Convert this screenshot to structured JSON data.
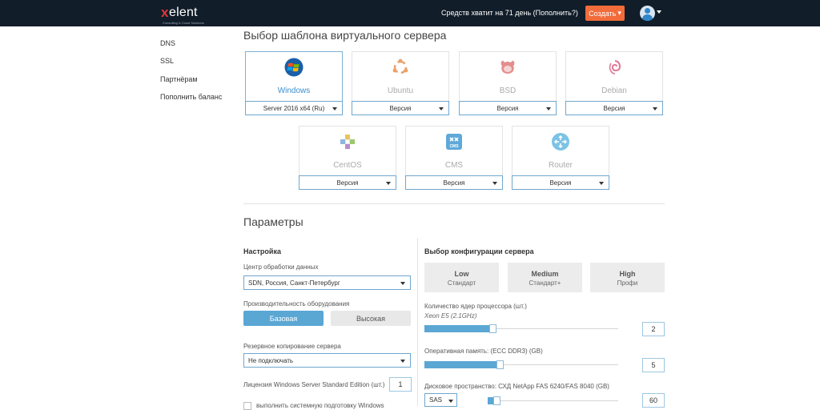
{
  "topbar": {
    "logo_x": "x",
    "logo_text": "elent",
    "logo_tagline": "Consulting & Cloud Solutions",
    "funds_text": "Средств хватит на 71 день (Пополнить?)",
    "create_label": "Создать",
    "create_caret": "▾",
    "colors": {
      "bar": "#111d29",
      "create": "#f26b3a",
      "logo_accent": "#e0373a"
    }
  },
  "sidebar": {
    "items": [
      {
        "label": "DNS"
      },
      {
        "label": "SSL"
      },
      {
        "label": "Партнёрам"
      },
      {
        "label": "Пополнить баланс"
      }
    ]
  },
  "templates": {
    "title": "Выбор шаблона виртуального сервера",
    "os": [
      {
        "name": "Windows",
        "icon": "windows-icon",
        "version": "Server 2016 x64 (Ru)",
        "selected": true
      },
      {
        "name": "Ubuntu",
        "icon": "ubuntu-icon",
        "version": "Версия",
        "selected": false
      },
      {
        "name": "BSD",
        "icon": "bsd-icon",
        "version": "Версия",
        "selected": false
      },
      {
        "name": "Debian",
        "icon": "debian-icon",
        "version": "Версия",
        "selected": false
      },
      {
        "name": "CentOS",
        "icon": "centos-icon",
        "version": "Версия",
        "selected": false
      },
      {
        "name": "CMS",
        "icon": "cms-icon",
        "version": "Версия",
        "selected": false
      },
      {
        "name": "Router",
        "icon": "router-icon",
        "version": "Версия",
        "selected": false
      }
    ]
  },
  "params": {
    "title": "Параметры",
    "settings": {
      "heading": "Настройка",
      "datacenter_label": "Центр обработки данных",
      "datacenter_value": "SDN, Россия, Санкт-Петербург",
      "performance_label": "Производительность оборудования",
      "performance_options": [
        "Базовая",
        "Высокая"
      ],
      "performance_selected": "Базовая",
      "backup_label": "Резервное копирование сервера",
      "backup_value": "Не подключать",
      "license_label": "Лицензия Windows Server Standard Edition (шт.)",
      "license_value": "1",
      "sysprep_label": "выполнить системную подготовку Windows"
    },
    "config": {
      "heading": "Выбор конфигурации сервера",
      "tiers": [
        {
          "name": "Low",
          "sub": "Стандарт"
        },
        {
          "name": "Medium",
          "sub": "Стандарт+"
        },
        {
          "name": "High",
          "sub": "Профи"
        }
      ],
      "cpu_label": "Количество ядер процессора (шт.)",
      "cpu_sub": "Xeon E5 (2.1GHz)",
      "cpu_value": "2",
      "cpu_fill_fraction": 0.35,
      "ram_label": "Оперативная память: (ECC DDR3) (GB)",
      "ram_value": "5",
      "ram_fill_fraction": 0.39,
      "disk_label": "Дисковое пространство: СХД NetApp FAS 6240/FAS 8040 (GB)",
      "disk_type": "SAS",
      "disk_value": "60",
      "disk_fill_fraction": 0.07,
      "accent": "#5aa7d4"
    }
  }
}
